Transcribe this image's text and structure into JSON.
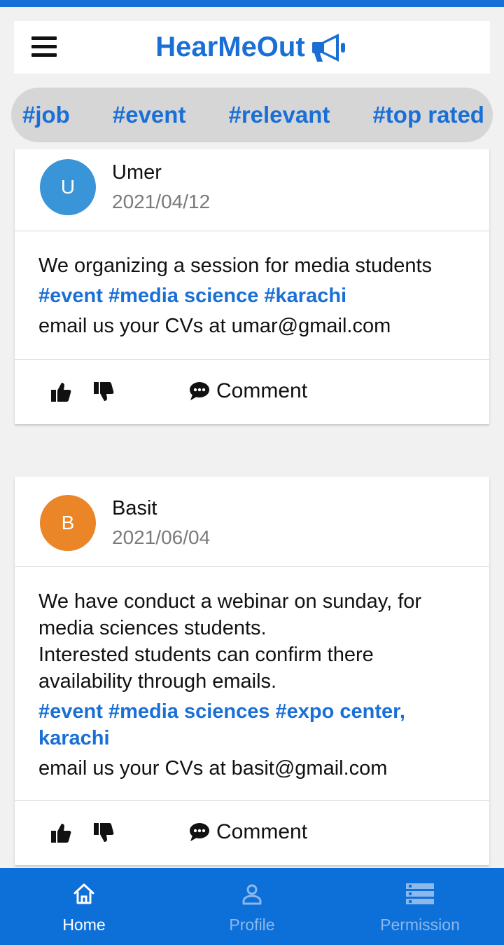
{
  "app": {
    "title": "HearMeOut",
    "brand_color": "#1a6fd6",
    "menu_icon": "hamburger-menu-icon",
    "brand_icon": "megaphone-icon"
  },
  "tags": [
    "#job",
    "#event",
    "#relevant",
    "#top rated"
  ],
  "posts": [
    {
      "author": "Umer",
      "initial": "U",
      "avatar_color": "#3a95d8",
      "date": "2021/04/12",
      "text": "We organizing a session for media students",
      "hashtags": "#event #media science #karachi",
      "email_line": "email us your CVs at umar@gmail.com",
      "comment_label": "Comment"
    },
    {
      "author": "Basit",
      "initial": "B",
      "avatar_color": "#ea8528",
      "date": "2021/06/04",
      "text": "We have conduct a webinar on sunday, for media sciences students.\nInterested students can confirm there availability through emails.",
      "hashtags": "#event #media sciences #expo center, karachi",
      "email_line": "email us your CVs at basit@gmail.com",
      "comment_label": "Comment"
    }
  ],
  "nav": [
    {
      "label": "Home",
      "icon": "home-icon",
      "active": true
    },
    {
      "label": "Profile",
      "icon": "person-icon",
      "active": false
    },
    {
      "label": "Permission",
      "icon": "server-icon",
      "active": false
    }
  ]
}
